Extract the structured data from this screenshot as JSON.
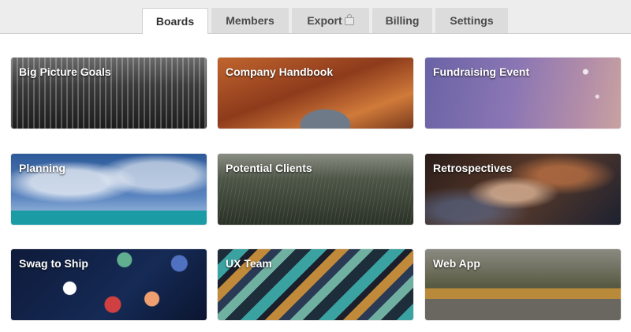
{
  "tabs": [
    {
      "label": "Boards",
      "active": true
    },
    {
      "label": "Members",
      "active": false
    },
    {
      "label": "Export",
      "active": false,
      "icon": "lock-icon"
    },
    {
      "label": "Billing",
      "active": false
    },
    {
      "label": "Settings",
      "active": false
    }
  ],
  "boards": [
    {
      "title": "Big Picture Goals",
      "background": "city skyline"
    },
    {
      "title": "Company Handbook",
      "background": "canyon"
    },
    {
      "title": "Fundraising Event",
      "background": "purple bokeh"
    },
    {
      "title": "Planning",
      "background": "sky and island"
    },
    {
      "title": "Potential Clients",
      "background": "grass"
    },
    {
      "title": "Retrospectives",
      "background": "nebula"
    },
    {
      "title": "Swag to Ship",
      "background": "bokeh lights"
    },
    {
      "title": "UX Team",
      "background": "colorful stripes"
    },
    {
      "title": "Web App",
      "background": "pond landscape"
    }
  ]
}
